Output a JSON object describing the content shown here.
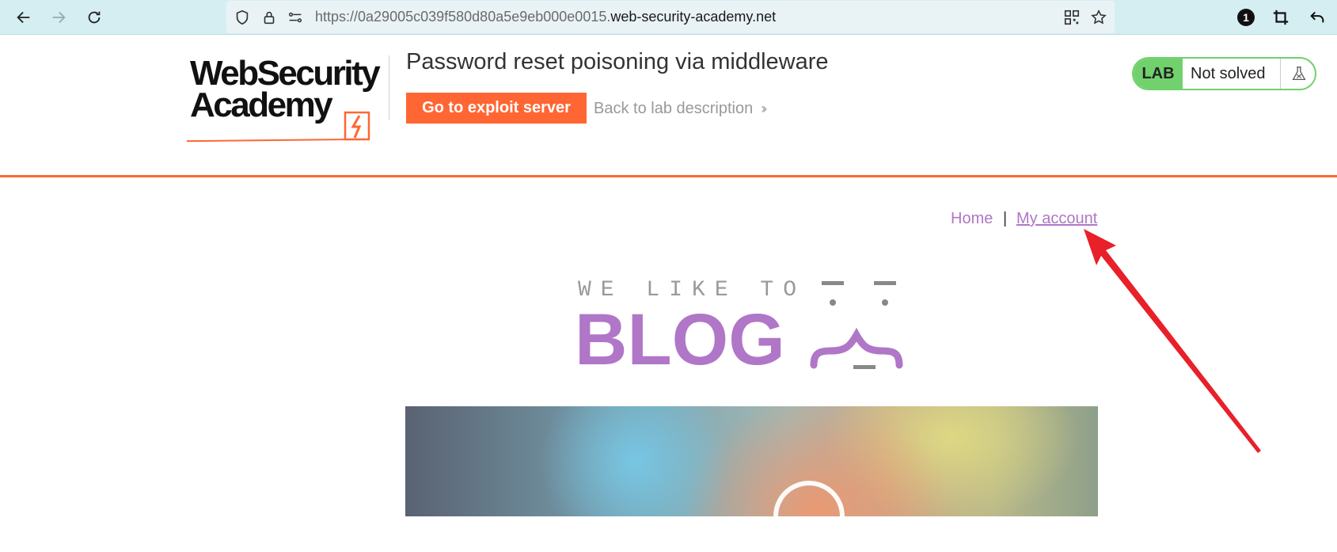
{
  "browser": {
    "url_prefix": "https://0a29005c039f580d80a5e9eb000e0015.",
    "url_domain": "web-security-academy.net",
    "notification_count": "1"
  },
  "header": {
    "logo_line1": "WebSecurity",
    "logo_line2": "Academy",
    "lab_title": "Password reset poisoning via middleware",
    "exploit_button": "Go to exploit server",
    "back_link": "Back to lab description",
    "badge_label": "LAB",
    "badge_status": "Not solved"
  },
  "nav": {
    "home": "Home",
    "separator": "|",
    "my_account": "My account"
  },
  "blog_logo": {
    "tagline": "WE LIKE TO",
    "word": "BLOG"
  },
  "colors": {
    "accent_orange": "#ff6633",
    "link_purple": "#b076c7",
    "lab_green": "#70d16d",
    "arrow_red": "#e8202a"
  }
}
